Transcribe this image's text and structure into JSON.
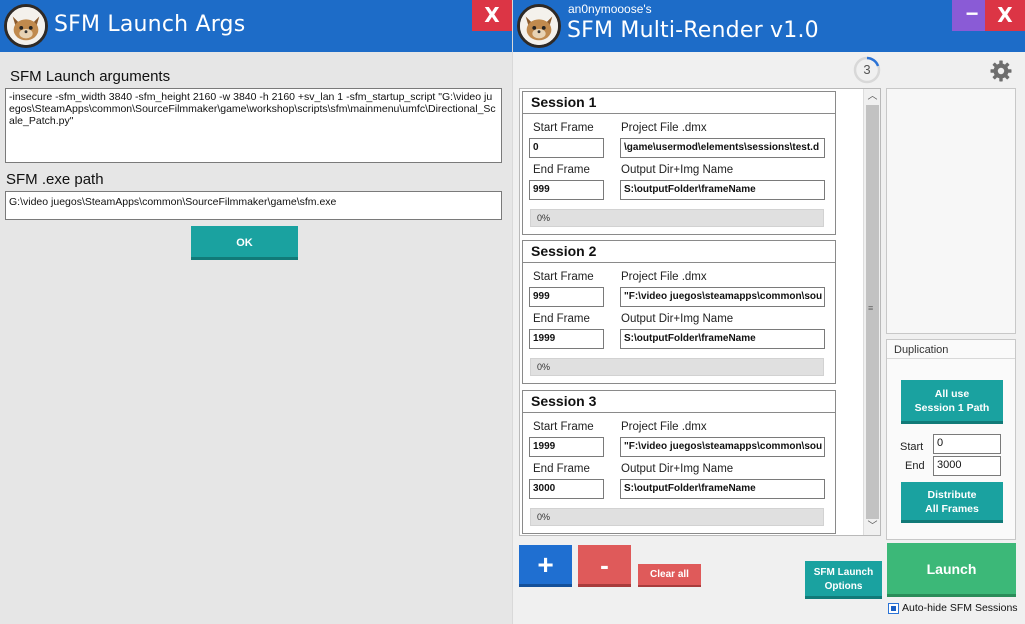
{
  "left_window": {
    "title": "SFM Launch Args",
    "close_label": "X",
    "launch_args_label": "SFM Launch arguments",
    "launch_args_value": "-insecure -sfm_width 3840 -sfm_height 2160 -w 3840 -h 2160 +sv_lan 1 -sfm_startup_script \"G:\\video juegos\\SteamApps\\common\\SourceFilmmaker\\game\\workshop\\scripts\\sfm\\mainmenu\\umfc\\Directional_Scale_Patch.py\"",
    "exe_path_label": "SFM .exe path",
    "exe_path_value": "G:\\video juegos\\SteamApps\\common\\SourceFilmmaker\\game\\sfm.exe",
    "ok_label": "OK"
  },
  "right_window": {
    "subtitle": "an0nymooose's",
    "title": "SFM Multi-Render v1.0",
    "minimize_label": "−",
    "close_label": "X",
    "session_count": "3",
    "sessions": [
      {
        "title": "Session 1",
        "start_frame_label": "Start Frame",
        "start_frame": "0",
        "end_frame_label": "End Frame",
        "end_frame": "999",
        "project_label": "Project File .dmx",
        "project_file": "\\game\\usermod\\elements\\sessions\\test.d",
        "output_label": "Output Dir+Img Name",
        "output_dir": "S:\\outputFolder\\frameName",
        "progress": 0,
        "progress_text": "0%"
      },
      {
        "title": "Session 2",
        "start_frame_label": "Start Frame",
        "start_frame": "999",
        "end_frame_label": "End Frame",
        "end_frame": "1999",
        "project_label": "Project File .dmx",
        "project_file": "\"F:\\video juegos\\steamapps\\common\\sou",
        "output_label": "Output Dir+Img Name",
        "output_dir": "S:\\outputFolder\\frameName",
        "progress": 0,
        "progress_text": "0%"
      },
      {
        "title": "Session 3",
        "start_frame_label": "Start Frame",
        "start_frame": "1999",
        "end_frame_label": "End Frame",
        "end_frame": "3000",
        "project_label": "Project File .dmx",
        "project_file": "\"F:\\video juegos\\steamapps\\common\\sou",
        "output_label": "Output Dir+Img Name",
        "output_dir": "S:\\outputFolder\\frameName",
        "progress": 0,
        "progress_text": "0%"
      }
    ],
    "add_label": "+",
    "remove_label": "-",
    "clear_label": "Clear all",
    "launch_options_line1": "SFM Launch",
    "launch_options_line2": "Options",
    "launch_label": "Launch",
    "autohide_label": "Auto-hide SFM Sessions",
    "duplication": {
      "label": "Duplication",
      "all_use_line1": "All use",
      "all_use_line2": "Session 1 Path",
      "start_label": "Start",
      "start_value": "0",
      "end_label": "End",
      "end_value": "3000",
      "distribute_line1": "Distribute",
      "distribute_line2": "All Frames"
    },
    "colors": {
      "titlebar": "#1d6cc8",
      "teal": "#1aa2a0",
      "green": "#3cb878",
      "blue": "#1f6fd1",
      "red": "#df5a5a",
      "close": "#dc3545",
      "minimize": "#8a5bd6"
    }
  }
}
